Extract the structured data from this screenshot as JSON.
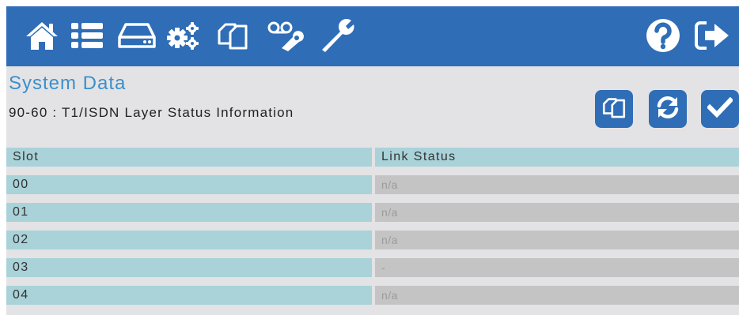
{
  "colors": {
    "topbar": "#2f6db6",
    "title": "#3c8fcb",
    "header_cell": "#a9d2d9",
    "value_cell": "#c4c4c4",
    "background": "#e3e3e5"
  },
  "toolbar": {
    "icons": [
      "home-icon",
      "list-icon",
      "drive-icon",
      "gears-icon",
      "copy-icon",
      "voicemail-icon",
      "wrench-icon",
      "help-icon",
      "logout-icon"
    ]
  },
  "page": {
    "title": "System Data",
    "subtitle": "90-60 : T1/ISDN Layer Status Information"
  },
  "actions": [
    "copy-icon",
    "refresh-icon",
    "check-icon"
  ],
  "table": {
    "headers": {
      "slot": "Slot",
      "link_status": "Link Status"
    },
    "rows": [
      {
        "slot": "00",
        "status": "n/a"
      },
      {
        "slot": "01",
        "status": "n/a"
      },
      {
        "slot": "02",
        "status": "n/a"
      },
      {
        "slot": "03",
        "status": "-"
      },
      {
        "slot": "04",
        "status": "n/a"
      }
    ]
  }
}
